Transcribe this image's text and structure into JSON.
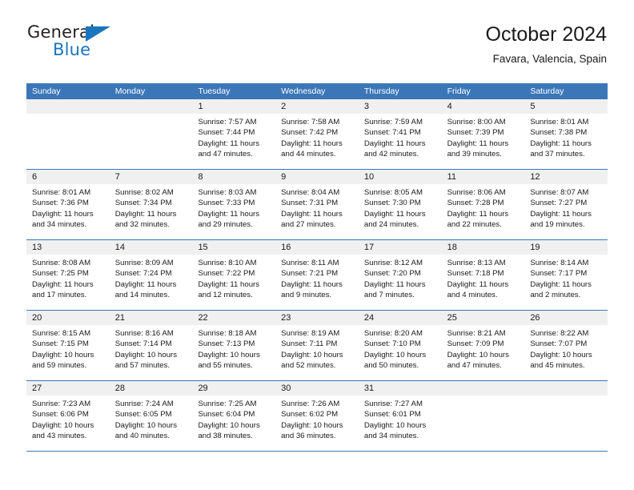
{
  "brand": {
    "line1": "General",
    "line2": "Blue",
    "logo_icon": "triangle-icon",
    "accent_color": "#1b75bc"
  },
  "header": {
    "title": "October 2024",
    "subtitle": "Favara, Valencia, Spain"
  },
  "calendar": {
    "header_bg": "#3b77b8",
    "daynum_band_bg": "#f0f0f0",
    "weekday_headers": [
      "Sunday",
      "Monday",
      "Tuesday",
      "Wednesday",
      "Thursday",
      "Friday",
      "Saturday"
    ],
    "weeks": [
      [
        {
          "day": "",
          "empty": true,
          "sunrise": "",
          "sunset": "",
          "daylight1": "",
          "daylight2": ""
        },
        {
          "day": "",
          "empty": true,
          "sunrise": "",
          "sunset": "",
          "daylight1": "",
          "daylight2": ""
        },
        {
          "day": "1",
          "empty": false,
          "sunrise": "Sunrise: 7:57 AM",
          "sunset": "Sunset: 7:44 PM",
          "daylight1": "Daylight: 11 hours",
          "daylight2": "and 47 minutes."
        },
        {
          "day": "2",
          "empty": false,
          "sunrise": "Sunrise: 7:58 AM",
          "sunset": "Sunset: 7:42 PM",
          "daylight1": "Daylight: 11 hours",
          "daylight2": "and 44 minutes."
        },
        {
          "day": "3",
          "empty": false,
          "sunrise": "Sunrise: 7:59 AM",
          "sunset": "Sunset: 7:41 PM",
          "daylight1": "Daylight: 11 hours",
          "daylight2": "and 42 minutes."
        },
        {
          "day": "4",
          "empty": false,
          "sunrise": "Sunrise: 8:00 AM",
          "sunset": "Sunset: 7:39 PM",
          "daylight1": "Daylight: 11 hours",
          "daylight2": "and 39 minutes."
        },
        {
          "day": "5",
          "empty": false,
          "sunrise": "Sunrise: 8:01 AM",
          "sunset": "Sunset: 7:38 PM",
          "daylight1": "Daylight: 11 hours",
          "daylight2": "and 37 minutes."
        }
      ],
      [
        {
          "day": "6",
          "empty": false,
          "sunrise": "Sunrise: 8:01 AM",
          "sunset": "Sunset: 7:36 PM",
          "daylight1": "Daylight: 11 hours",
          "daylight2": "and 34 minutes."
        },
        {
          "day": "7",
          "empty": false,
          "sunrise": "Sunrise: 8:02 AM",
          "sunset": "Sunset: 7:34 PM",
          "daylight1": "Daylight: 11 hours",
          "daylight2": "and 32 minutes."
        },
        {
          "day": "8",
          "empty": false,
          "sunrise": "Sunrise: 8:03 AM",
          "sunset": "Sunset: 7:33 PM",
          "daylight1": "Daylight: 11 hours",
          "daylight2": "and 29 minutes."
        },
        {
          "day": "9",
          "empty": false,
          "sunrise": "Sunrise: 8:04 AM",
          "sunset": "Sunset: 7:31 PM",
          "daylight1": "Daylight: 11 hours",
          "daylight2": "and 27 minutes."
        },
        {
          "day": "10",
          "empty": false,
          "sunrise": "Sunrise: 8:05 AM",
          "sunset": "Sunset: 7:30 PM",
          "daylight1": "Daylight: 11 hours",
          "daylight2": "and 24 minutes."
        },
        {
          "day": "11",
          "empty": false,
          "sunrise": "Sunrise: 8:06 AM",
          "sunset": "Sunset: 7:28 PM",
          "daylight1": "Daylight: 11 hours",
          "daylight2": "and 22 minutes."
        },
        {
          "day": "12",
          "empty": false,
          "sunrise": "Sunrise: 8:07 AM",
          "sunset": "Sunset: 7:27 PM",
          "daylight1": "Daylight: 11 hours",
          "daylight2": "and 19 minutes."
        }
      ],
      [
        {
          "day": "13",
          "empty": false,
          "sunrise": "Sunrise: 8:08 AM",
          "sunset": "Sunset: 7:25 PM",
          "daylight1": "Daylight: 11 hours",
          "daylight2": "and 17 minutes."
        },
        {
          "day": "14",
          "empty": false,
          "sunrise": "Sunrise: 8:09 AM",
          "sunset": "Sunset: 7:24 PM",
          "daylight1": "Daylight: 11 hours",
          "daylight2": "and 14 minutes."
        },
        {
          "day": "15",
          "empty": false,
          "sunrise": "Sunrise: 8:10 AM",
          "sunset": "Sunset: 7:22 PM",
          "daylight1": "Daylight: 11 hours",
          "daylight2": "and 12 minutes."
        },
        {
          "day": "16",
          "empty": false,
          "sunrise": "Sunrise: 8:11 AM",
          "sunset": "Sunset: 7:21 PM",
          "daylight1": "Daylight: 11 hours",
          "daylight2": "and 9 minutes."
        },
        {
          "day": "17",
          "empty": false,
          "sunrise": "Sunrise: 8:12 AM",
          "sunset": "Sunset: 7:20 PM",
          "daylight1": "Daylight: 11 hours",
          "daylight2": "and 7 minutes."
        },
        {
          "day": "18",
          "empty": false,
          "sunrise": "Sunrise: 8:13 AM",
          "sunset": "Sunset: 7:18 PM",
          "daylight1": "Daylight: 11 hours",
          "daylight2": "and 4 minutes."
        },
        {
          "day": "19",
          "empty": false,
          "sunrise": "Sunrise: 8:14 AM",
          "sunset": "Sunset: 7:17 PM",
          "daylight1": "Daylight: 11 hours",
          "daylight2": "and 2 minutes."
        }
      ],
      [
        {
          "day": "20",
          "empty": false,
          "sunrise": "Sunrise: 8:15 AM",
          "sunset": "Sunset: 7:15 PM",
          "daylight1": "Daylight: 10 hours",
          "daylight2": "and 59 minutes."
        },
        {
          "day": "21",
          "empty": false,
          "sunrise": "Sunrise: 8:16 AM",
          "sunset": "Sunset: 7:14 PM",
          "daylight1": "Daylight: 10 hours",
          "daylight2": "and 57 minutes."
        },
        {
          "day": "22",
          "empty": false,
          "sunrise": "Sunrise: 8:18 AM",
          "sunset": "Sunset: 7:13 PM",
          "daylight1": "Daylight: 10 hours",
          "daylight2": "and 55 minutes."
        },
        {
          "day": "23",
          "empty": false,
          "sunrise": "Sunrise: 8:19 AM",
          "sunset": "Sunset: 7:11 PM",
          "daylight1": "Daylight: 10 hours",
          "daylight2": "and 52 minutes."
        },
        {
          "day": "24",
          "empty": false,
          "sunrise": "Sunrise: 8:20 AM",
          "sunset": "Sunset: 7:10 PM",
          "daylight1": "Daylight: 10 hours",
          "daylight2": "and 50 minutes."
        },
        {
          "day": "25",
          "empty": false,
          "sunrise": "Sunrise: 8:21 AM",
          "sunset": "Sunset: 7:09 PM",
          "daylight1": "Daylight: 10 hours",
          "daylight2": "and 47 minutes."
        },
        {
          "day": "26",
          "empty": false,
          "sunrise": "Sunrise: 8:22 AM",
          "sunset": "Sunset: 7:07 PM",
          "daylight1": "Daylight: 10 hours",
          "daylight2": "and 45 minutes."
        }
      ],
      [
        {
          "day": "27",
          "empty": false,
          "sunrise": "Sunrise: 7:23 AM",
          "sunset": "Sunset: 6:06 PM",
          "daylight1": "Daylight: 10 hours",
          "daylight2": "and 43 minutes."
        },
        {
          "day": "28",
          "empty": false,
          "sunrise": "Sunrise: 7:24 AM",
          "sunset": "Sunset: 6:05 PM",
          "daylight1": "Daylight: 10 hours",
          "daylight2": "and 40 minutes."
        },
        {
          "day": "29",
          "empty": false,
          "sunrise": "Sunrise: 7:25 AM",
          "sunset": "Sunset: 6:04 PM",
          "daylight1": "Daylight: 10 hours",
          "daylight2": "and 38 minutes."
        },
        {
          "day": "30",
          "empty": false,
          "sunrise": "Sunrise: 7:26 AM",
          "sunset": "Sunset: 6:02 PM",
          "daylight1": "Daylight: 10 hours",
          "daylight2": "and 36 minutes."
        },
        {
          "day": "31",
          "empty": false,
          "sunrise": "Sunrise: 7:27 AM",
          "sunset": "Sunset: 6:01 PM",
          "daylight1": "Daylight: 10 hours",
          "daylight2": "and 34 minutes."
        },
        {
          "day": "",
          "empty": true,
          "sunrise": "",
          "sunset": "",
          "daylight1": "",
          "daylight2": ""
        },
        {
          "day": "",
          "empty": true,
          "sunrise": "",
          "sunset": "",
          "daylight1": "",
          "daylight2": ""
        }
      ]
    ]
  }
}
